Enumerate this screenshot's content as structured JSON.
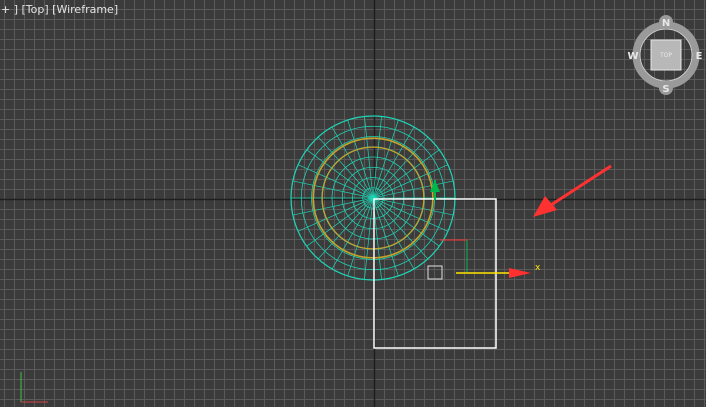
{
  "viewport": {
    "label_parts": [
      "+",
      "Top",
      "Wireframe"
    ],
    "background_color": "#3b3b3b",
    "grid_minor_color": "#5a5a5a",
    "grid_major_color": "#1e1e1e"
  },
  "view_cube": {
    "face_label": "TOP",
    "compass": {
      "north": "N",
      "east": "E",
      "south": "S",
      "west": "W"
    }
  },
  "sphere": {
    "wire_color": "#1fd3b4",
    "ring_color": "#c7a32a"
  },
  "rectangle": {
    "color": "#ffffff"
  },
  "gizmo": {
    "x_label": "x",
    "x_color": "#ffe600",
    "y_color": "#00b84a",
    "z_color": "#ff3030"
  },
  "annotation_arrow": {
    "color": "#ff3232"
  },
  "corner_axis": {
    "x_color": "#d04040",
    "y_color": "#40c040"
  }
}
